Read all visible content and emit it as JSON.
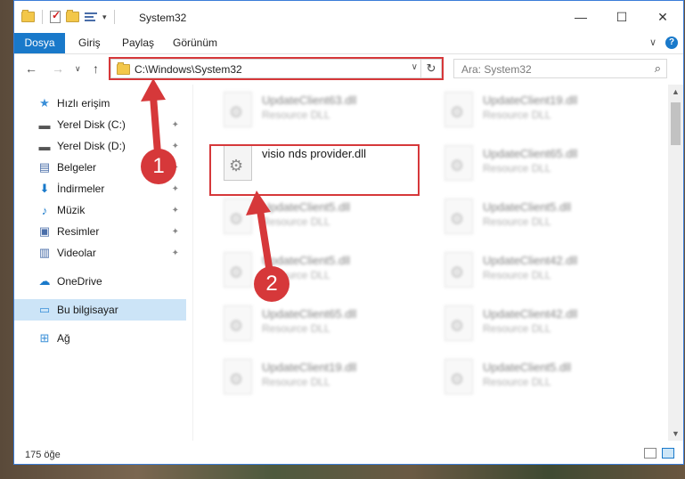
{
  "window": {
    "title": "System32"
  },
  "titlebar": {
    "minimize": "—",
    "maximize": "☐",
    "close": "✕"
  },
  "ribbon": {
    "tabs": [
      "Dosya",
      "Giriş",
      "Paylaş",
      "Görünüm"
    ],
    "expand_label": "∨",
    "help_label": "?"
  },
  "nav": {
    "back": "←",
    "forward": "→",
    "recent": "∨",
    "up": "↑",
    "address": "C:\\Windows\\System32",
    "address_drop": "∨",
    "refresh": "↻",
    "search_placeholder": "Ara: System32",
    "search_icon": "⌕"
  },
  "sidebar": {
    "items": [
      {
        "label": "Hızlı erişim",
        "icon": "star-icon",
        "glyph": "★",
        "color": "#3a8fd8",
        "pinned": false
      },
      {
        "label": "Yerel Disk (C:)",
        "icon": "drive-icon",
        "glyph": "▬",
        "color": "#555555",
        "pinned": true
      },
      {
        "label": "Yerel Disk (D:)",
        "icon": "drive-icon",
        "glyph": "▬",
        "color": "#555555",
        "pinned": true
      },
      {
        "label": "Belgeler",
        "icon": "documents-icon",
        "glyph": "▤",
        "color": "#4a6ea9",
        "pinned": true
      },
      {
        "label": "İndirmeler",
        "icon": "downloads-icon",
        "glyph": "⬇",
        "color": "#1979ca",
        "pinned": true
      },
      {
        "label": "Müzik",
        "icon": "music-icon",
        "glyph": "♪",
        "color": "#1979ca",
        "pinned": true
      },
      {
        "label": "Resimler",
        "icon": "pictures-icon",
        "glyph": "▣",
        "color": "#4a6ea9",
        "pinned": true
      },
      {
        "label": "Videolar",
        "icon": "videos-icon",
        "glyph": "▥",
        "color": "#4a6ea9",
        "pinned": true
      },
      {
        "label": "OneDrive",
        "icon": "onedrive-icon",
        "glyph": "☁",
        "color": "#1979ca",
        "pinned": false
      },
      {
        "label": "Bu bilgisayar",
        "icon": "computer-icon",
        "glyph": "▭",
        "color": "#3a8fd8",
        "pinned": false,
        "selected": true
      },
      {
        "label": "Ağ",
        "icon": "network-icon",
        "glyph": "⊞",
        "color": "#3a8fd8",
        "pinned": false
      }
    ],
    "pin_glyph": "✦"
  },
  "files": {
    "left": [
      {
        "name": "UpdateClient63.dll",
        "type": "Resource DLL",
        "blurred": true
      },
      {
        "name": "visio nds provider.dll",
        "type": "",
        "blurred": false
      },
      {
        "name": "UpdateClient5.dll",
        "type": "Resource DLL",
        "blurred": true
      },
      {
        "name": "UpdateClient5.dll",
        "type": "Resource DLL",
        "blurred": true
      },
      {
        "name": "UpdateClient65.dll",
        "type": "Resource DLL",
        "blurred": true
      },
      {
        "name": "UpdateClient19.dll",
        "type": "Resource DLL",
        "blurred": true
      }
    ],
    "right": [
      {
        "name": "UpdateClient19.dll",
        "type": "Resource DLL",
        "blurred": true
      },
      {
        "name": "UpdateClient65.dll",
        "type": "Resource DLL",
        "blurred": true
      },
      {
        "name": "UpdateClient5.dll",
        "type": "Resource DLL",
        "blurred": true
      },
      {
        "name": "UpdateClient42.dll",
        "type": "Resource DLL",
        "blurred": true
      },
      {
        "name": "UpdateClient42.dll",
        "type": "Resource DLL",
        "blurred": true
      },
      {
        "name": "UpdateClient5.dll",
        "type": "Resource DLL",
        "blurred": true
      }
    ],
    "gear_glyph": "⚙"
  },
  "scrollbar": {
    "up": "▲",
    "down": "▼"
  },
  "status": {
    "item_count": "175 öğe"
  },
  "annotations": {
    "step1": "1",
    "step2": "2",
    "color": "#d6383a"
  }
}
